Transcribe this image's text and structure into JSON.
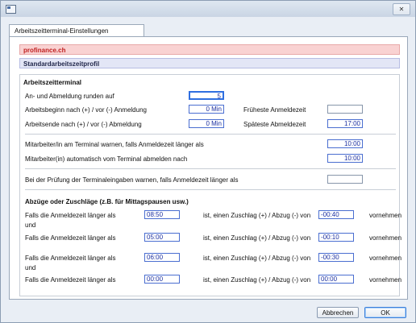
{
  "window": {
    "close_glyph": "✕"
  },
  "tab": {
    "label": "Arbeitszeitterminal-Einstellungen"
  },
  "banners": {
    "company": "profinance.ch",
    "profile": "Standardarbeitszeitprofil"
  },
  "terminal": {
    "heading": "Arbeitszeitterminal",
    "round_label": "An- und Abmeldung runden auf",
    "round_value": "5",
    "start_label": "Arbeitsbeginn nach (+) / vor (-) Anmeldung",
    "start_value": "0 Min",
    "earliest_label": "Früheste Anmeldezeit",
    "earliest_value": "",
    "end_label": "Arbeitsende nach (+) / vor (-) Abmeldung",
    "end_value": "0 Min",
    "latest_label": "Späteste Abmeldezeit",
    "latest_value": "17:00",
    "warn_label": "Mitarbeiter/in am Terminal warnen, falls Anmeldezeit länger als",
    "warn_value": "10:00",
    "auto_label": "Mitarbeiter(in) automatisch vom Terminal abmelden nach",
    "auto_value": "10:00",
    "check_label": "Bei der Prüfung der Terminaleingaben warnen, falls Anmeldezeit länger als",
    "check_value": ""
  },
  "adjustments": {
    "heading": "Abzüge oder Zuschläge (z.B. für Mittagspausen usw.)",
    "prefix": "Falls die Anmeldezeit länger als",
    "middle": "ist, einen Zuschlag (+) / Abzug (-) von",
    "suffix": "vornehmen",
    "conjunction": "und",
    "rows": [
      {
        "time": "08:50",
        "amount": "-00:40"
      },
      {
        "time": "05:00",
        "amount": "-00:10"
      },
      {
        "time": "06:00",
        "amount": "-00:30"
      },
      {
        "time": "00:00",
        "amount": "00:00"
      }
    ]
  },
  "buttons": {
    "cancel": "Abbrechen",
    "ok": "OK"
  }
}
